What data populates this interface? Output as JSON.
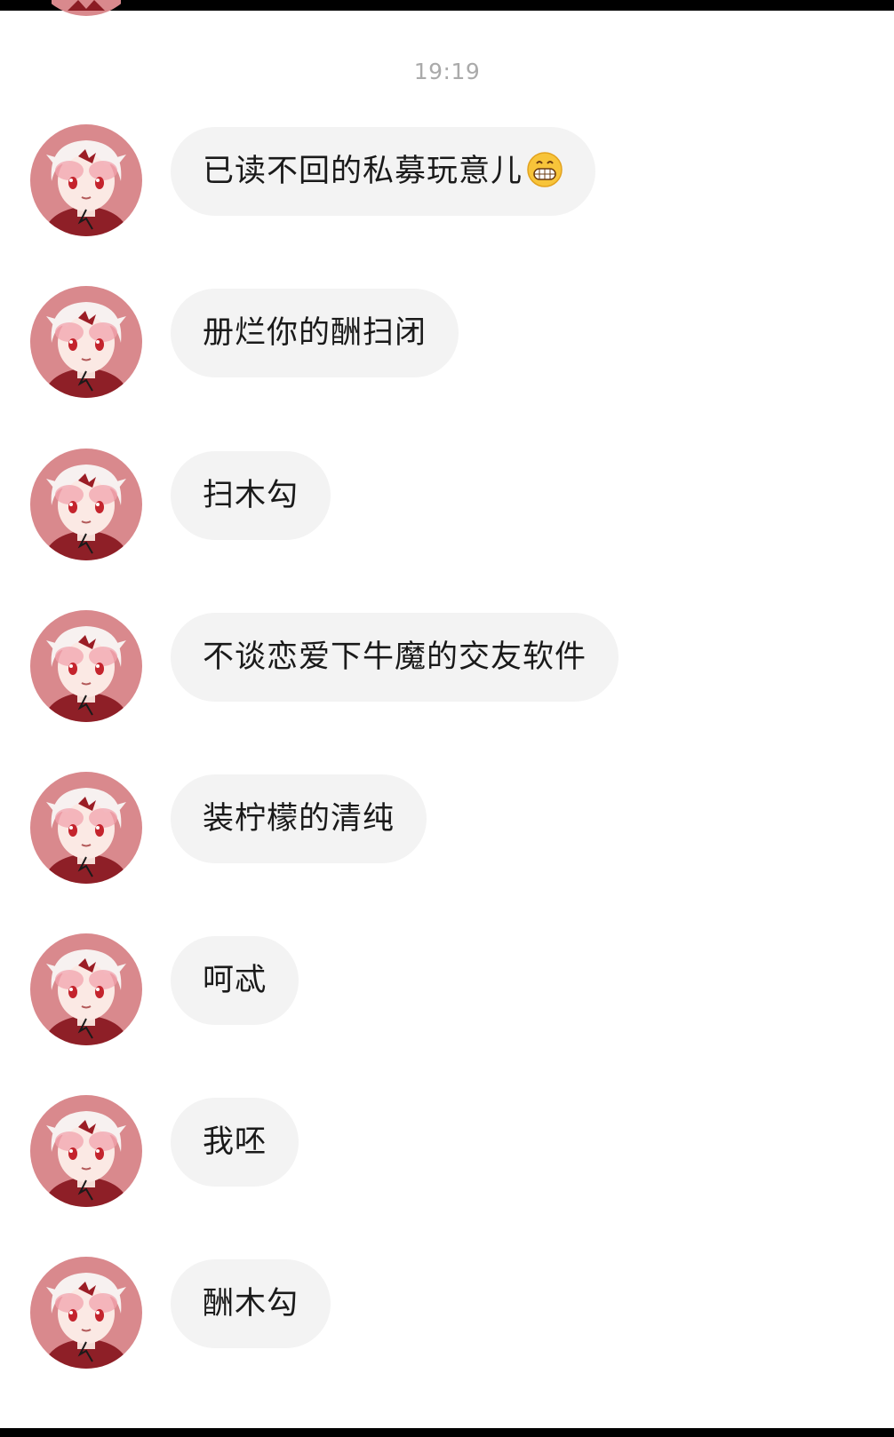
{
  "chat": {
    "timestamp": "19:19",
    "messages": [
      {
        "text": "已读不回的私募玩意儿",
        "emoji": "grinning-face-emoji"
      },
      {
        "text": "册烂你的酬扫闭"
      },
      {
        "text": "扫木勾"
      },
      {
        "text": "不谈恋爱下牛魔的交友软件"
      },
      {
        "text": "装柠檬的清纯"
      },
      {
        "text": "呵忒"
      },
      {
        "text": "我呸"
      },
      {
        "text": "酬木勾"
      }
    ]
  },
  "theme": {
    "bubble_bg": "#f3f3f3",
    "avatar_bg": "#d9898d",
    "text_color": "#1a1a1a",
    "timestamp_color": "#aaaaaa"
  }
}
